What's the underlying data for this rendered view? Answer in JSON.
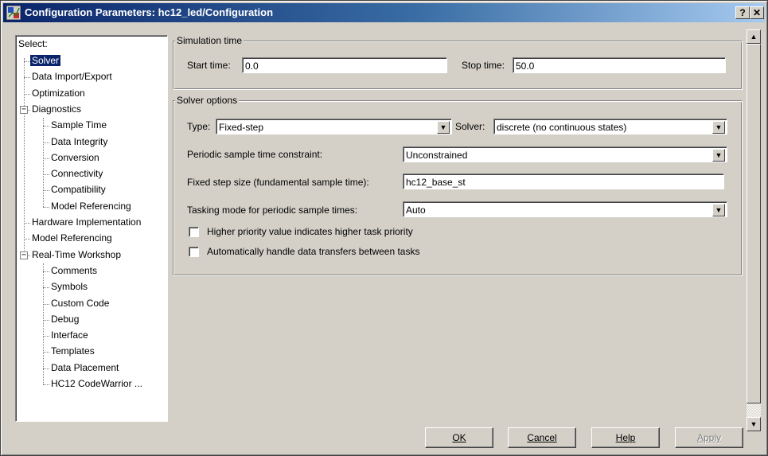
{
  "window": {
    "title": "Configuration Parameters: hc12_led/Configuration",
    "help_glyph": "?",
    "close_glyph": "✕"
  },
  "tree": {
    "header": "Select:",
    "items": [
      {
        "label": "Solver",
        "selected": true
      },
      {
        "label": "Data Import/Export"
      },
      {
        "label": "Optimization"
      },
      {
        "label": "Diagnostics",
        "expander": "−"
      },
      {
        "label": "Sample Time"
      },
      {
        "label": "Data Integrity"
      },
      {
        "label": "Conversion"
      },
      {
        "label": "Connectivity"
      },
      {
        "label": "Compatibility"
      },
      {
        "label": "Model Referencing"
      },
      {
        "label": "Hardware Implementation"
      },
      {
        "label": "Model Referencing"
      },
      {
        "label": "Real-Time Workshop",
        "expander": "−"
      },
      {
        "label": "Comments"
      },
      {
        "label": "Symbols"
      },
      {
        "label": "Custom Code"
      },
      {
        "label": "Debug"
      },
      {
        "label": "Interface"
      },
      {
        "label": "Templates"
      },
      {
        "label": "Data Placement"
      },
      {
        "label": "HC12 CodeWarrior ..."
      }
    ]
  },
  "simulation_time": {
    "title": "Simulation time",
    "start_label": "Start time:",
    "start_value": "0.0",
    "stop_label": "Stop time:",
    "stop_value": "50.0"
  },
  "solver_options": {
    "title": "Solver options",
    "type_label": "Type:",
    "type_value": "Fixed-step",
    "solver_label": "Solver:",
    "solver_value": "discrete (no continuous states)",
    "periodic_label": "Periodic sample time constraint:",
    "periodic_value": "Unconstrained",
    "fixed_step_label": "Fixed step size (fundamental sample time):",
    "fixed_step_value": "hc12_base_st",
    "tasking_label": "Tasking mode for periodic sample times:",
    "tasking_value": "Auto",
    "check_priority_label": "Higher priority value indicates higher task priority",
    "check_priority_checked": false,
    "check_transfers_label": "Automatically handle data transfers between tasks",
    "check_transfers_checked": false
  },
  "buttons": {
    "ok": "OK",
    "cancel": "Cancel",
    "help": "Help",
    "apply": "Apply",
    "apply_enabled": false
  },
  "icons": {
    "dropdown": "▼",
    "scroll_up": "▲",
    "scroll_down": "▼"
  }
}
